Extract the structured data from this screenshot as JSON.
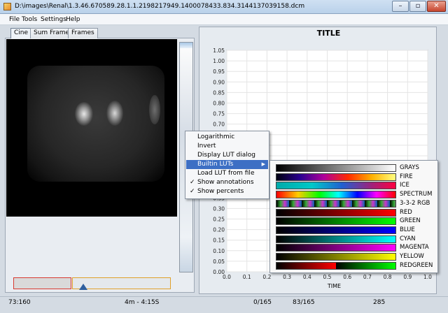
{
  "window": {
    "title": "D:\\images\\Renal\\1.3.46.670589.28.1.1.2198217949.1400078433.834.3144137039158.dcm"
  },
  "menubar": {
    "items": [
      "File",
      "Tools",
      "Settings",
      "Help"
    ]
  },
  "tabs": [
    {
      "label": "Cine",
      "active": true
    },
    {
      "label": "Sum Frame"
    },
    {
      "label": "Frames"
    }
  ],
  "chart_data": {
    "type": "line",
    "title": "TITLE",
    "xlabel": "TIME",
    "ylabel": "",
    "xlim": [
      0,
      1
    ],
    "ylim": [
      0,
      1.05
    ],
    "xticks": [
      "0.0",
      "0.1",
      "0.2",
      "0.3",
      "0.4",
      "0.5",
      "0.6",
      "0.7",
      "0.8",
      "0.9",
      "1.0"
    ],
    "yticks": [
      "0.00",
      "0.05",
      "0.10",
      "0.15",
      "0.20",
      "0.25",
      "0.30",
      "0.35",
      "0.40",
      "0.45",
      "0.50",
      "0.55",
      "0.60",
      "0.65",
      "0.70",
      "0.75",
      "0.80",
      "0.85",
      "0.90",
      "0.95",
      "1.00",
      "1.05"
    ],
    "series": [],
    "grid": true
  },
  "context_menu": {
    "items": [
      {
        "label": "Logarithmic",
        "check": false
      },
      {
        "label": "Invert",
        "check": false
      },
      {
        "label": "Display LUT dialog",
        "check": false
      },
      {
        "label": "Builtin LUTs",
        "check": false,
        "submenu": true,
        "highlighted": true
      },
      {
        "label": "Load LUT from file",
        "check": false
      },
      {
        "label": "Show annotations",
        "check": true
      },
      {
        "label": "Show percents",
        "check": true
      }
    ],
    "check_glyph": "✓",
    "submenu_glyph": "▶"
  },
  "lut_menu": {
    "items": [
      {
        "name": "GRAYS",
        "gradient": "linear-gradient(90deg,#000,#fff)"
      },
      {
        "name": "FIRE",
        "gradient": "linear-gradient(90deg,#000010,#2b0090 20%,#b0009a 40%,#ff2a00 60%,#ffb000 80%,#ffff80)"
      },
      {
        "name": "ICE",
        "gradient": "linear-gradient(90deg,#00aaaa,#00c8c8 30%,#2060d0 55%,#a0207a 80%,#ff0040)"
      },
      {
        "name": "SPECTRUM",
        "gradient": "linear-gradient(90deg,#ff0000,#ffcc00 18%,#00ff00 36%,#00ffff 52%,#0000ff 68%,#ff00ff 84%,#ff0000)"
      },
      {
        "name": "3-3-2 RGB",
        "gradient": "repeating-linear-gradient(90deg,#000 0,#3a3 6px,#c3c 12px,#06a 18px)"
      },
      {
        "name": "RED",
        "gradient": "linear-gradient(90deg,#000,#ff0000)"
      },
      {
        "name": "GREEN",
        "gradient": "linear-gradient(90deg,#000,#00ff00)"
      },
      {
        "name": "BLUE",
        "gradient": "linear-gradient(90deg,#000,#0000ff)"
      },
      {
        "name": "CYAN",
        "gradient": "linear-gradient(90deg,#000,#00ffff)"
      },
      {
        "name": "MAGENTA",
        "gradient": "linear-gradient(90deg,#000,#ff00ff)"
      },
      {
        "name": "YELLOW",
        "gradient": "linear-gradient(90deg,#000,#ffff00)"
      },
      {
        "name": "REDGREEN",
        "gradient": "linear-gradient(90deg,#000,#ff0000 50%,#000 50%,#00ff00)"
      }
    ]
  },
  "status": {
    "position": "73:160",
    "time": "4m - 4:15S",
    "frame_start": "0/165",
    "frame_current": "83/165",
    "value": "285"
  },
  "colors": {
    "selection": "#3d6fc4",
    "timeline_red": "#d83a30",
    "timeline_orange": "#e0a02a"
  }
}
